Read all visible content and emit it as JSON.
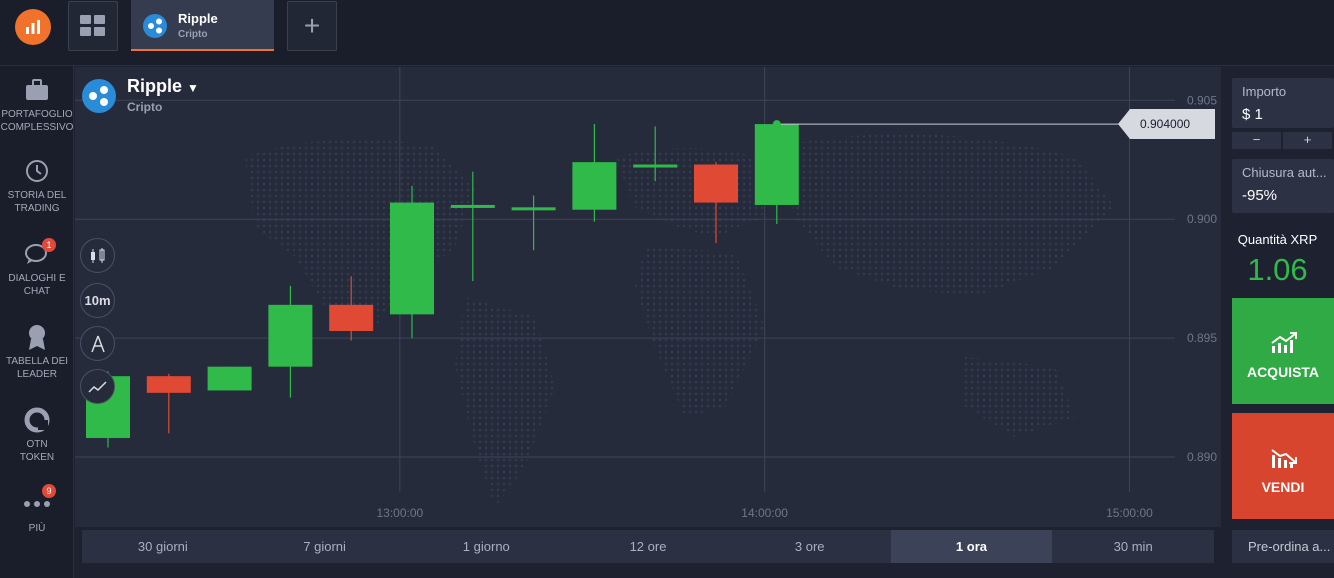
{
  "topbar": {
    "asset_tab": {
      "name": "Ripple",
      "category": "Cripto"
    },
    "add_tab_label": "+"
  },
  "sidebar": {
    "items": [
      {
        "label": "PORTAFOGLIO\nCOMPLESSIVO",
        "icon": "briefcase-icon"
      },
      {
        "label": "STORIA DEL\nTRADING",
        "icon": "history-icon"
      },
      {
        "label": "DIALOGHI E\nCHAT",
        "icon": "chat-icon",
        "badge": "1"
      },
      {
        "label": "TABELLA DEI\nLEADER",
        "icon": "award-icon"
      },
      {
        "label": "OTN\nTOKEN",
        "icon": "token-icon"
      },
      {
        "label": "PIÙ",
        "icon": "more-icon",
        "badge": "9"
      }
    ]
  },
  "asset": {
    "name": "Ripple",
    "category": "Cripto"
  },
  "tools": {
    "timeframe_label": "10m"
  },
  "chart_data": {
    "type": "candlestick",
    "y_ticks": [
      "0.905",
      "0.900",
      "0.895",
      "0.890"
    ],
    "ylim": [
      0.8879,
      0.9064
    ],
    "x_ticks": [
      "13:00:00",
      "14:00:00",
      "15:00:00"
    ],
    "current_price": "0.904000",
    "candles": [
      {
        "open": 0.8908,
        "close": 0.8934,
        "high": 0.8936,
        "low": 0.8904
      },
      {
        "open": 0.8934,
        "close": 0.8927,
        "high": 0.8935,
        "low": 0.891
      },
      {
        "open": 0.8928,
        "close": 0.8938,
        "high": 0.8938,
        "low": 0.8928
      },
      {
        "open": 0.8938,
        "close": 0.8964,
        "high": 0.8972,
        "low": 0.8925
      },
      {
        "open": 0.8964,
        "close": 0.8953,
        "high": 0.8976,
        "low": 0.8949
      },
      {
        "open": 0.896,
        "close": 0.9007,
        "high": 0.9014,
        "low": 0.895
      },
      {
        "open": 0.9006,
        "close": 0.9006,
        "high": 0.902,
        "low": 0.8974
      },
      {
        "open": 0.9005,
        "close": 0.9005,
        "high": 0.901,
        "low": 0.8987
      },
      {
        "open": 0.9004,
        "close": 0.9024,
        "high": 0.904,
        "low": 0.8999
      },
      {
        "open": 0.9023,
        "close": 0.9023,
        "high": 0.9039,
        "low": 0.9016
      },
      {
        "open": 0.9023,
        "close": 0.9007,
        "high": 0.9024,
        "low": 0.899
      },
      {
        "open": 0.9006,
        "close": 0.904,
        "high": 0.904,
        "low": 0.8998
      }
    ]
  },
  "periods": [
    {
      "label": "30 giorni",
      "active": false
    },
    {
      "label": "7 giorni",
      "active": false
    },
    {
      "label": "1 giorno",
      "active": false
    },
    {
      "label": "12 ore",
      "active": false
    },
    {
      "label": "3 ore",
      "active": false
    },
    {
      "label": "1 ora",
      "active": true
    },
    {
      "label": "30 min",
      "active": false
    }
  ],
  "trade": {
    "amount_label": "Importo",
    "amount_value": "$  1",
    "minus_label": "−",
    "plus_label": "+",
    "autoclose_label": "Chiusura aut...",
    "autoclose_value": "-95%",
    "qty_label": "Quantità XRP",
    "qty_value": "1.06",
    "buy_label": "ACQUISTA",
    "sell_label": "VENDI",
    "preorder_label": "Pre-ordina a..."
  },
  "colors": {
    "up": "#2fba4a",
    "down": "#e04a35",
    "accent": "#f0722b"
  }
}
